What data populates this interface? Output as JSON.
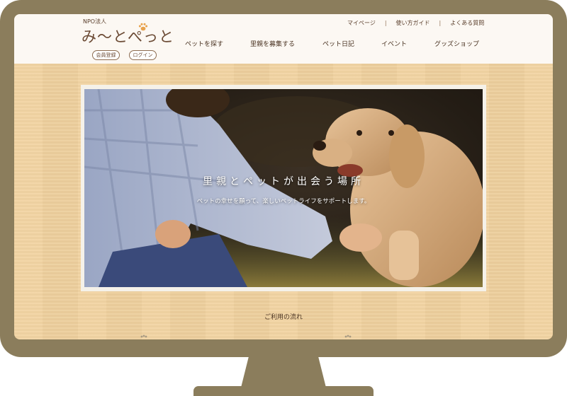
{
  "header": {
    "logo_org": "NPO法人",
    "logo_name": "み〜とぺっと",
    "register_label": "会員登録",
    "login_label": "ログイン",
    "utility_nav": [
      "マイページ",
      "使い方ガイド",
      "よくある質問"
    ],
    "main_nav": [
      "ペットを探す",
      "里親を募集する",
      "ペット日記",
      "イベント",
      "グッズショップ"
    ]
  },
  "hero": {
    "title": "里親とペットが出会う場所",
    "subtitle": "ペットの幸せを願って、楽しいペットライフをサポートします。"
  },
  "section": {
    "flow_title": "ご利用の流れ"
  },
  "colors": {
    "monitor_frame": "#8b7d5c",
    "wood_background": "#f2d3a0",
    "header_background": "#fcf8f3",
    "text_brown": "#5a3e2b",
    "paw_accent": "#e8a24c"
  },
  "icons": {
    "logo_paw": "paw-icon"
  }
}
